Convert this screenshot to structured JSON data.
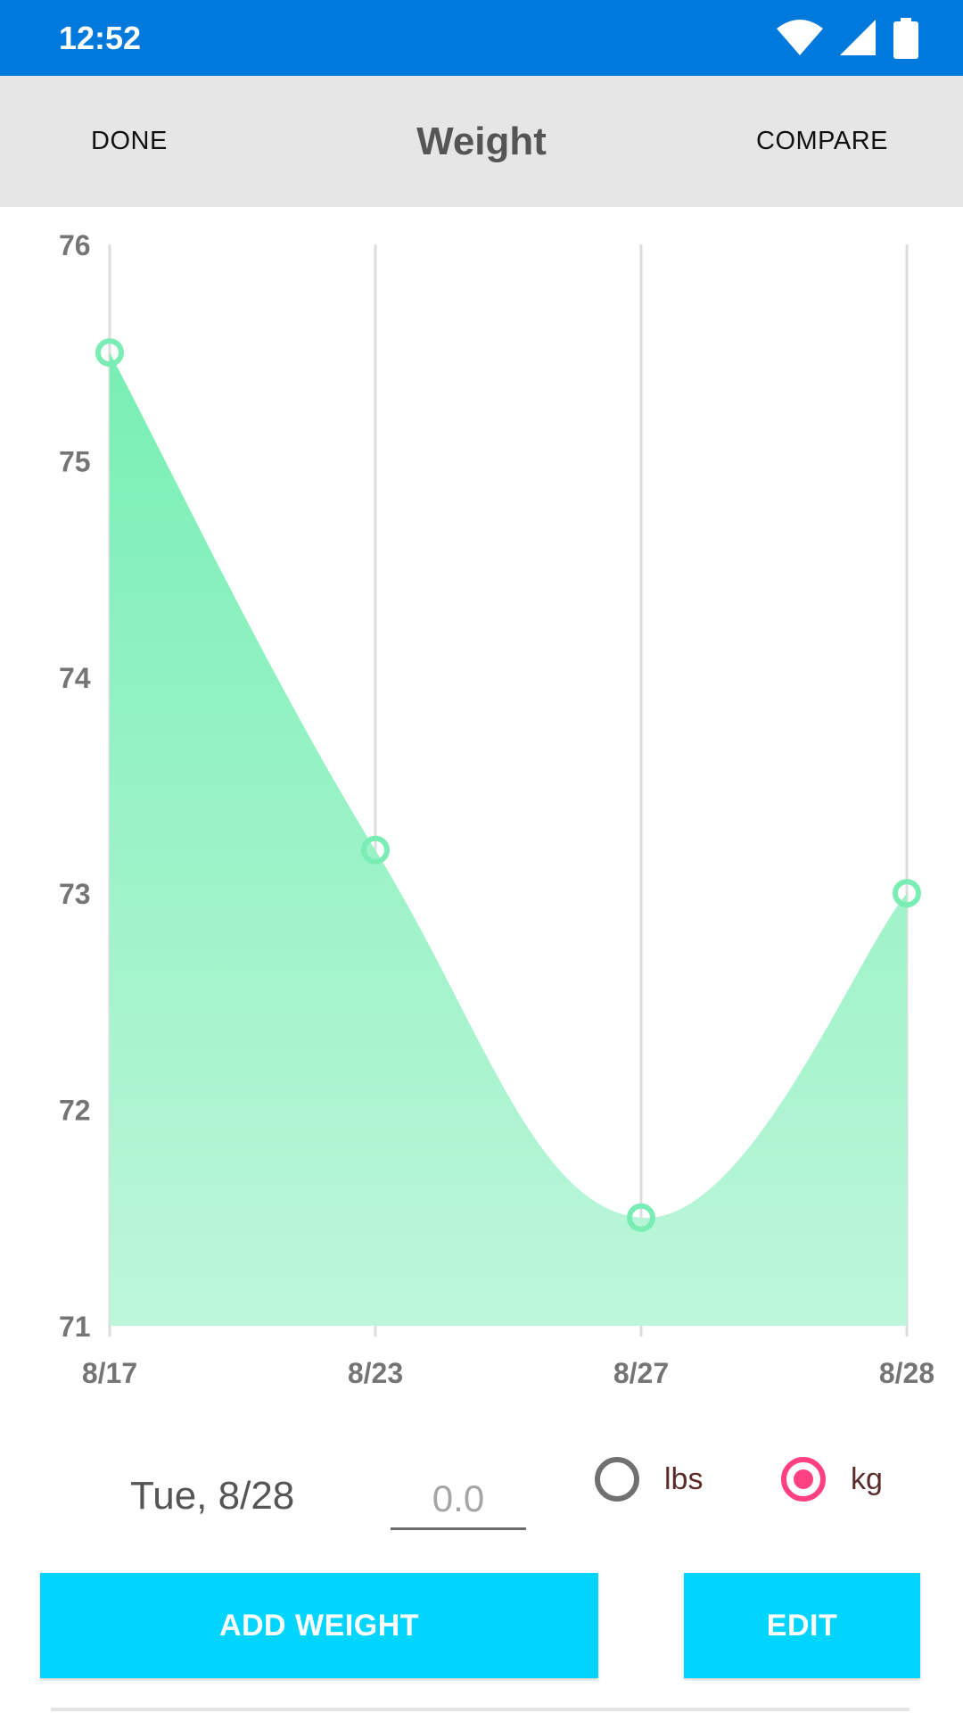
{
  "status_bar": {
    "time": "12:52",
    "icons": [
      "wifi-icon",
      "cell-signal-icon",
      "battery-icon"
    ],
    "color": "#0079DC"
  },
  "toolbar": {
    "done_label": "DONE",
    "title": "Weight",
    "compare_label": "COMPARE"
  },
  "chart_data": {
    "type": "area",
    "categories": [
      "8/17",
      "8/23",
      "8/27",
      "8/28"
    ],
    "series": [
      {
        "values": [
          75.5,
          73.2,
          71.5,
          73.0
        ]
      }
    ],
    "yticks": [
      "71",
      "72",
      "73",
      "74",
      "75",
      "76"
    ],
    "ylim": [
      71,
      76
    ],
    "title": "",
    "xlabel": "",
    "ylabel": "",
    "grid": "vertical",
    "fill_color_top": "#78EFB4",
    "fill_color_bottom": "#BDF6DA",
    "marker_color": "#7AEDB4",
    "grid_color": "#DDDDDD"
  },
  "entry": {
    "date_label": "Tue, 8/28",
    "weight_value": "",
    "weight_placeholder": "0.0"
  },
  "units": {
    "lbs_label": "lbs",
    "kg_label": "kg",
    "selected": "kg",
    "accent_color": "#FF4081"
  },
  "actions": {
    "add_label": "ADD WEIGHT",
    "edit_label": "EDIT",
    "color": "#00D5FF"
  }
}
